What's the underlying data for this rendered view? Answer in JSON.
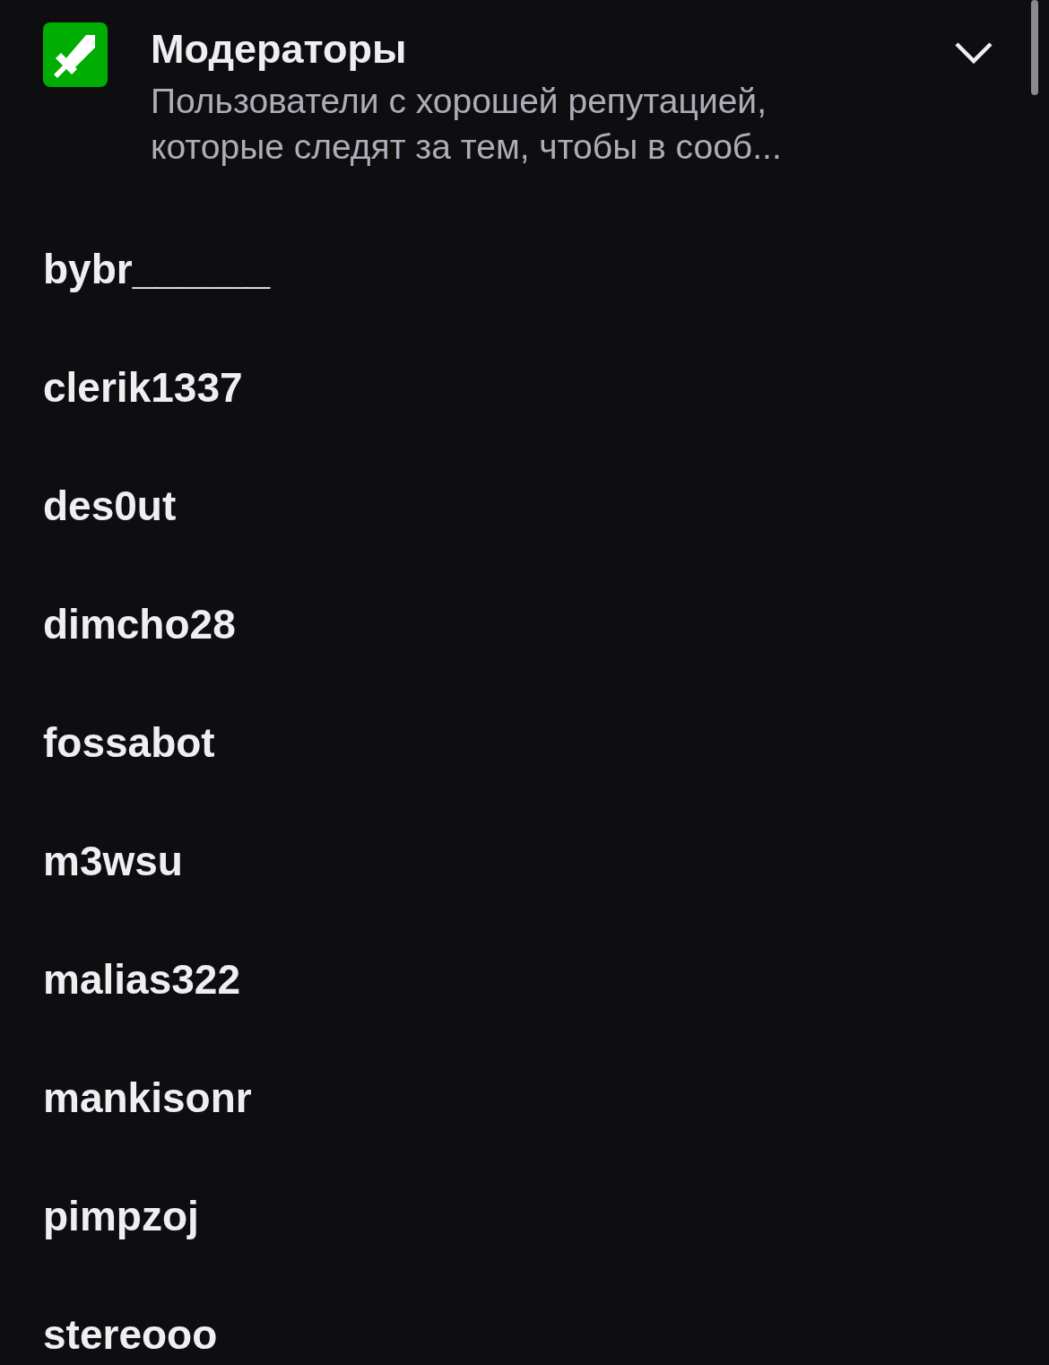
{
  "group": {
    "title": "Модераторы",
    "description": "Пользователи с хорошей репутацией, которые следят за тем, чтобы в сооб...",
    "expanded": true
  },
  "members": [
    {
      "name": "bybr______"
    },
    {
      "name": "clerik1337"
    },
    {
      "name": "des0ut"
    },
    {
      "name": "dimcho28"
    },
    {
      "name": "fossabot"
    },
    {
      "name": "m3wsu"
    },
    {
      "name": "malias322"
    },
    {
      "name": "mankisonr"
    },
    {
      "name": "pimpzoj"
    },
    {
      "name": "stereooo"
    }
  ]
}
